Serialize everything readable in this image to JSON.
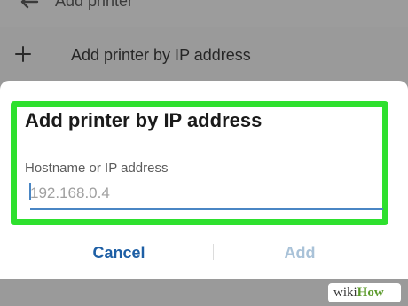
{
  "appbar": {
    "title": "Add printer",
    "back_icon": "arrow-left-icon"
  },
  "menu_row": {
    "icon": "plus-icon",
    "label": "Add printer by IP address"
  },
  "dialog": {
    "title": "Add printer by IP address",
    "field_label": "Hostname or IP address",
    "field_placeholder": "192.168.0.4",
    "field_value": "",
    "cancel_label": "Cancel",
    "add_label": "Add",
    "highlight_color": "#2ee02e",
    "accent_color": "#1e5fa5"
  },
  "watermark": {
    "prefix": "wiki",
    "suffix": "How"
  }
}
